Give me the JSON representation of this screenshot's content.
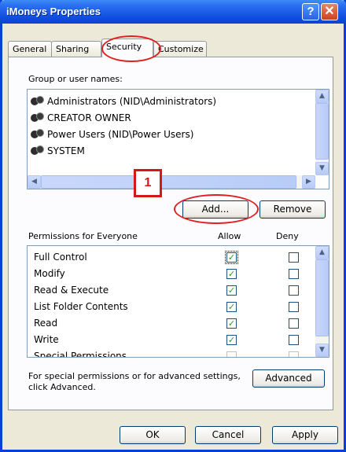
{
  "window": {
    "title": "iMoneys Properties",
    "help_glyph": "?",
    "close_glyph": "✕"
  },
  "tabs": [
    "General",
    "Sharing",
    "Security",
    "Customize"
  ],
  "active_tab": "Security",
  "groups": {
    "label": "Group or user names:",
    "users": [
      "Administrators (NID\\Administrators)",
      "CREATOR OWNER",
      "Power Users (NID\\Power Users)",
      "SYSTEM"
    ]
  },
  "buttons": {
    "add": "Add...",
    "remove": "Remove",
    "advanced": "Advanced",
    "ok": "OK",
    "cancel": "Cancel",
    "apply": "Apply"
  },
  "permissions": {
    "label": "Permissions for Everyone",
    "allow_header": "Allow",
    "deny_header": "Deny",
    "rows": [
      {
        "name": "Full Control",
        "allow": true,
        "deny": false
      },
      {
        "name": "Modify",
        "allow": true,
        "deny": false
      },
      {
        "name": "Read & Execute",
        "allow": true,
        "deny": false
      },
      {
        "name": "List Folder Contents",
        "allow": true,
        "deny": false
      },
      {
        "name": "Read",
        "allow": true,
        "deny": false
      },
      {
        "name": "Write",
        "allow": true,
        "deny": false
      },
      {
        "name": "Special Permissions",
        "allow": false,
        "deny": false
      }
    ]
  },
  "advanced_text": "For special permissions or for advanced settings, click Advanced.",
  "annotation": {
    "step": "1"
  },
  "colors": {
    "highlight": "#e02020",
    "titlebar": "#0b44cf",
    "check": "#21a121"
  }
}
